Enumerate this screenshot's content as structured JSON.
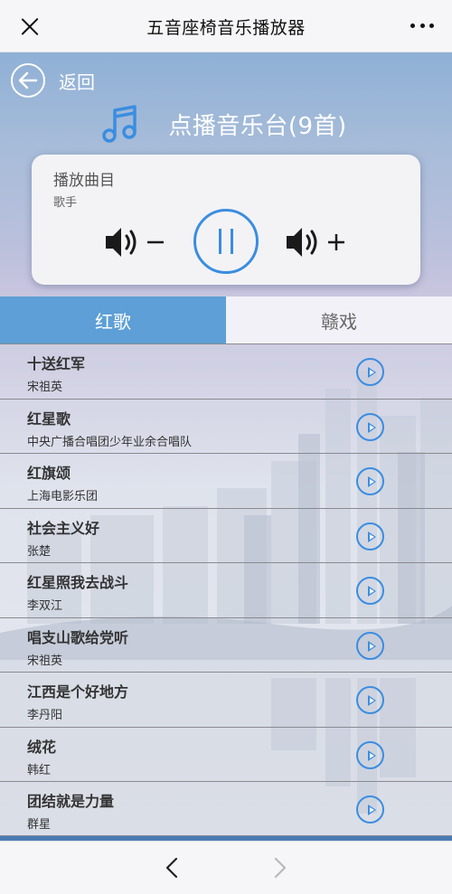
{
  "window": {
    "title": "五音座椅音乐播放器",
    "close_icon": "close-icon",
    "more_icon": "more-dots-icon"
  },
  "header": {
    "back_label": "返回",
    "radio_title": "点播音乐台(9首)",
    "note_icon": "music-note-icon"
  },
  "player": {
    "song_label": "播放曲目",
    "artist_label": "歌手",
    "vol_down_icon": "volume-down-icon",
    "vol_up_icon": "volume-up-icon",
    "pause_icon": "pause-icon"
  },
  "tabs": [
    {
      "label": "红歌",
      "active": true
    },
    {
      "label": "赣戏",
      "active": false
    }
  ],
  "songs": [
    {
      "name": "十送红军",
      "singer": "宋祖英"
    },
    {
      "name": "红星歌",
      "singer": "中央广播合唱团少年业余合唱队"
    },
    {
      "name": "红旗颂",
      "singer": "上海电影乐团"
    },
    {
      "name": "社会主义好",
      "singer": "张楚"
    },
    {
      "name": "红星照我去战斗",
      "singer": "李双江"
    },
    {
      "name": "唱支山歌给党听",
      "singer": "宋祖英"
    },
    {
      "name": "江西是个好地方",
      "singer": "李丹阳"
    },
    {
      "name": "绒花",
      "singer": "韩红"
    },
    {
      "name": "团结就是力量",
      "singer": "群星"
    }
  ],
  "colors": {
    "accent": "#3b8de0",
    "tab_active": "#5d9fd6"
  },
  "nav": {
    "prev_icon": "chevron-left-icon",
    "next_icon": "chevron-right-icon"
  }
}
